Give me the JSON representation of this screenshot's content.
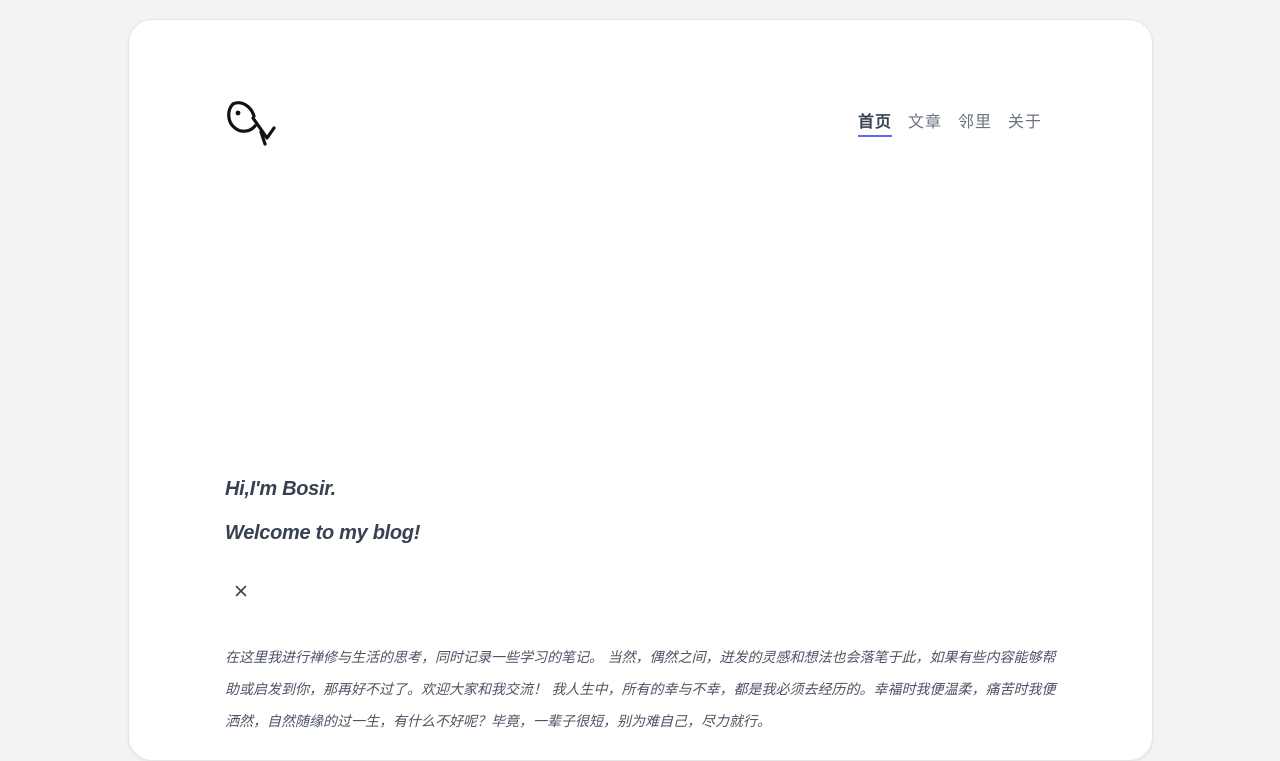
{
  "header": {
    "logo_icon": "fish-logo-icon",
    "nav": [
      {
        "label": "首页",
        "active": true
      },
      {
        "label": "文章",
        "active": false
      },
      {
        "label": "邻里",
        "active": false
      },
      {
        "label": "关于",
        "active": false
      }
    ]
  },
  "hero": {
    "line1": "Hi,I'm Bosir.",
    "line2": "Welcome to my blog!",
    "close_icon": "close-icon"
  },
  "intro": {
    "text": "在这里我进行禅修与生活的思考，同时记录一些学习的笔记。 当然，偶然之间，迸发的灵感和想法也会落笔于此，如果有些内容能够帮助或启发到你，那再好不过了。欢迎大家和我交流！ 我人生中，所有的幸与不幸，都是我必须去经历的。幸福时我便温柔，痛苦时我便洒然，自然随缘的过一生，有什么不好呢？毕竟，一辈子很短，别为难自己，尽力就行。"
  },
  "colors": {
    "background": "#f2f3f5",
    "card": "#ffffff",
    "accent": "#6366f1",
    "text_dark": "#374151",
    "text_muted": "#6b7280"
  }
}
